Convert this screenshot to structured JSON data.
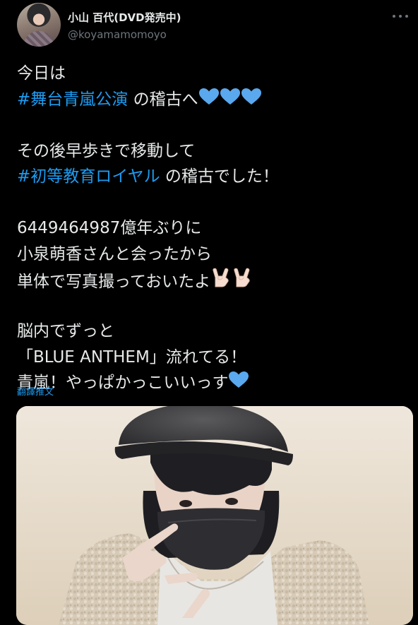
{
  "user": {
    "display_name": "小山 百代(DVD発売中)",
    "handle": "@koyamamomoyo"
  },
  "icons": {
    "avatar": "user-avatar",
    "more": "more-horizontal-icon",
    "heart": "blue-heart-emoji",
    "hand": "sign-of-horns-emoji"
  },
  "tweet": {
    "l1": "今日は",
    "hashtag1": "#舞台青嵐公演",
    "l2_after": " の稽古へ",
    "l3": "その後早歩きで移動して",
    "hashtag2": "#初等教育ロイヤル",
    "l4_after": " の稽古でした！",
    "l5": "6449464987億年ぶりに",
    "l6": "小泉萌香さんと会ったから",
    "l7": "単体で写真撮っておいたよ",
    "l8": "脳内でずっと",
    "l9": "「BLUE ANTHEM」流れてる！",
    "l10": "青嵐！やっぱかっこいいっす"
  },
  "translate_label": "翻譯推文",
  "colors": {
    "background": "#000000",
    "text": "#e7e9ea",
    "secondary": "#6e767d",
    "link": "#1d9bf0",
    "heart": "#5aa8ee"
  }
}
